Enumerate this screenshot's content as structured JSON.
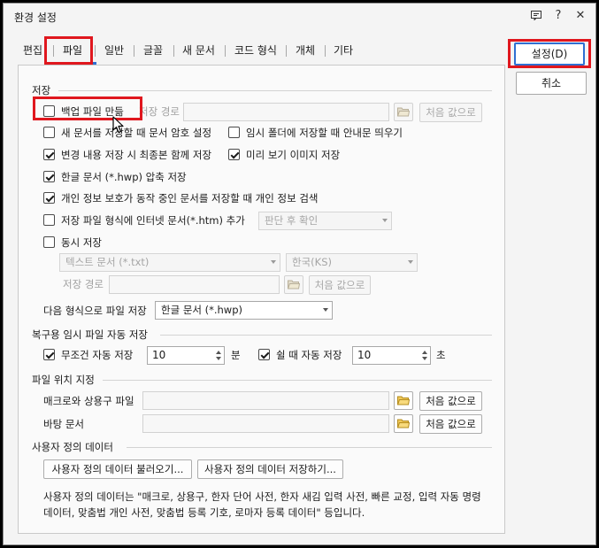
{
  "dialog": {
    "title": "환경 설정",
    "title_buttons": [
      "help-window-icon",
      "question-icon",
      "close-icon"
    ],
    "help_label": "?",
    "close_label": "✕"
  },
  "tabs": [
    {
      "label": "편집",
      "selected": false
    },
    {
      "label": "파일",
      "selected": true
    },
    {
      "label": "일반",
      "selected": false
    },
    {
      "label": "글꼴",
      "selected": false
    },
    {
      "label": "새 문서",
      "selected": false
    },
    {
      "label": "코드 형식",
      "selected": false
    },
    {
      "label": "개체",
      "selected": false
    },
    {
      "label": "기타",
      "selected": false
    }
  ],
  "buttons": {
    "ok": "설정(D)",
    "cancel": "취소"
  },
  "save": {
    "section_title": "저장",
    "backup": {
      "label": "백업 파일 만듦",
      "checked": false
    },
    "save_path_label": "저장 경로",
    "save_path_value": "",
    "reset_label": "처음 값으로",
    "encrypt_new": {
      "label": "새 문서를 저장할 때 문서 암호 설정",
      "checked": false
    },
    "temp_folder_notice": {
      "label": "임시 폴더에 저장할 때 안내문 띄우기",
      "checked": false
    },
    "save_final_with_changes": {
      "label": "변경 내용 저장 시 최종본 함께 저장",
      "checked": true
    },
    "save_preview": {
      "label": "미리 보기 이미지 저장",
      "checked": true
    },
    "compress_hwp": {
      "label": "한글 문서 (*.hwp) 압축 저장",
      "checked": true
    },
    "personal_info_check": {
      "label": "개인 정보 보호가 동작 중인 문서를 저장할 때 개인 정보 검색",
      "checked": true
    },
    "add_htm": {
      "label": "저장 파일 형식에 인터넷 문서(*.htm) 추가",
      "checked": false
    },
    "add_htm_option": "판단 후 확인",
    "simultaneous": {
      "label": "동시 저장",
      "checked": false
    },
    "sim_format": "텍스트 문서 (*.txt)",
    "sim_encoding": "한국(KS)",
    "sim_path_label": "저장 경로",
    "sim_path_value": "",
    "sim_reset_label": "처음 값으로",
    "next_format_label": "다음 형식으로 파일 저장",
    "next_format_value": "한글 문서 (*.hwp)"
  },
  "autosave": {
    "section_title": "복구용 임시 파일 자동 저장",
    "unconditional": {
      "label": "무조건 자동 저장",
      "checked": true,
      "value": "10",
      "unit": "분"
    },
    "idle": {
      "label": "쉴 때 자동 저장",
      "checked": true,
      "value": "10",
      "unit": "초"
    }
  },
  "file_location": {
    "section_title": "파일 위치 지정",
    "macro_label": "매크로와 상용구 파일",
    "macro_value": "",
    "background_label": "바탕 문서",
    "background_value": "",
    "reset_label": "처음 값으로"
  },
  "user_data": {
    "section_title": "사용자 정의 데이터",
    "load_label": "사용자 정의 데이터 불러오기...",
    "save_label": "사용자 정의 데이터 저장하기...",
    "description": "사용자 정의 데이터는 \"매크로, 상용구, 한자 단어 사전, 한자 새김 입력 사전, 빠른 교정, 입력 자동 명령 데이터, 맞춤법 개인 사전, 맞춤법 등록 기호, 로마자 등록 데이터\" 등입니다."
  },
  "colors": {
    "highlight": "#e0171e",
    "accent": "#2f6fd2",
    "disabled_text": "#a0a0a0"
  }
}
